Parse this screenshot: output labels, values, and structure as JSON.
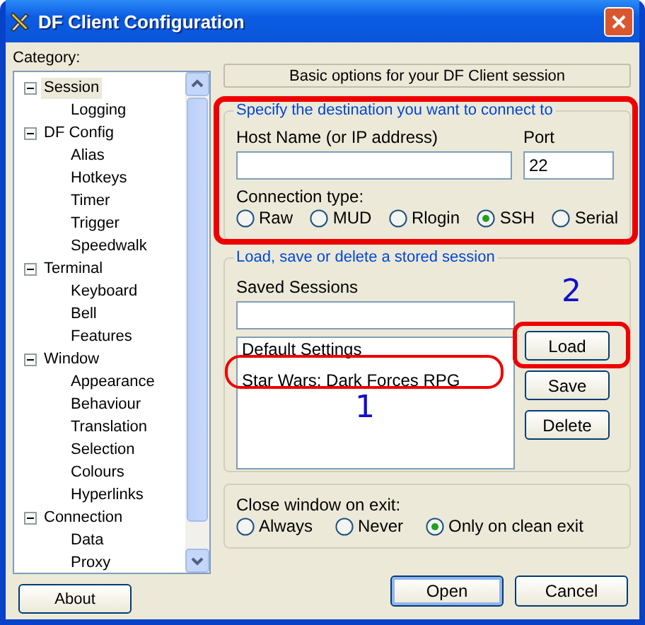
{
  "window": {
    "title": "DF Client Configuration"
  },
  "category_label": "Category:",
  "tree": [
    {
      "label": "Session",
      "expanded": true,
      "selected": true,
      "children": [
        {
          "label": "Logging",
          "selected": false
        }
      ]
    },
    {
      "label": "DF Config",
      "expanded": true,
      "selected": false,
      "children": [
        {
          "label": "Alias",
          "selected": false
        },
        {
          "label": "Hotkeys",
          "selected": false
        },
        {
          "label": "Timer",
          "selected": false
        },
        {
          "label": "Trigger",
          "selected": false
        },
        {
          "label": "Speedwalk",
          "selected": false
        }
      ]
    },
    {
      "label": "Terminal",
      "expanded": true,
      "selected": false,
      "children": [
        {
          "label": "Keyboard",
          "selected": false
        },
        {
          "label": "Bell",
          "selected": false
        },
        {
          "label": "Features",
          "selected": false
        }
      ]
    },
    {
      "label": "Window",
      "expanded": true,
      "selected": false,
      "children": [
        {
          "label": "Appearance",
          "selected": false
        },
        {
          "label": "Behaviour",
          "selected": false
        },
        {
          "label": "Translation",
          "selected": false
        },
        {
          "label": "Selection",
          "selected": false
        },
        {
          "label": "Colours",
          "selected": false
        },
        {
          "label": "Hyperlinks",
          "selected": false
        }
      ]
    },
    {
      "label": "Connection",
      "expanded": true,
      "selected": false,
      "children": [
        {
          "label": "Data",
          "selected": false
        },
        {
          "label": "Proxy",
          "selected": false
        }
      ]
    }
  ],
  "about_button": "About",
  "panel_header": "Basic options for your DF Client session",
  "destination": {
    "legend": "Specify the destination you want to connect to",
    "host_label": "Host Name (or IP address)",
    "port_label": "Port",
    "port_value": "22",
    "connection_type_label": "Connection type:",
    "connection_types": [
      {
        "label": "Raw",
        "selected": false
      },
      {
        "label": "MUD",
        "selected": false
      },
      {
        "label": "Rlogin",
        "selected": false
      },
      {
        "label": "SSH",
        "selected": true
      },
      {
        "label": "Serial",
        "selected": false
      }
    ]
  },
  "sessions": {
    "legend": "Load, save or delete a stored session",
    "saved_label": "Saved Sessions",
    "list": [
      {
        "label": "Default Settings",
        "selected": false
      },
      {
        "label": "Star Wars: Dark Forces RPG",
        "selected": false
      }
    ],
    "buttons": [
      "Load",
      "Save",
      "Delete"
    ]
  },
  "close_on_exit": {
    "label": "Close window on exit:",
    "options": [
      {
        "label": "Always",
        "selected": false
      },
      {
        "label": "Never",
        "selected": false
      },
      {
        "label": "Only on clean exit",
        "selected": true
      }
    ]
  },
  "buttons": [
    "Open",
    "Cancel"
  ],
  "annotation_numbers": [
    "1",
    "2"
  ]
}
